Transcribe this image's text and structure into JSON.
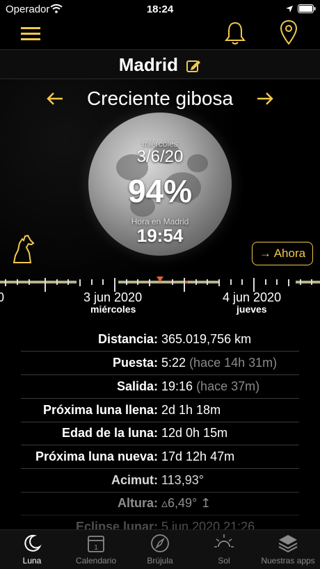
{
  "status": {
    "carrier": "Operador",
    "time": "18:24"
  },
  "header": {
    "menu_icon": "hamburger-icon",
    "bell_icon": "bell-icon",
    "location_icon": "map-pin-icon"
  },
  "city": {
    "name": "Madrid"
  },
  "phase": {
    "name": "Creciente gibosa"
  },
  "moon": {
    "weekday": "miércoles",
    "date": "3/6/20",
    "illumination": "94%",
    "time_label": "Hora en Madrid",
    "time": "19:54"
  },
  "now_button": {
    "label": "→ Ahora"
  },
  "timeline": {
    "left_partial": "0",
    "dates": [
      {
        "date": "3 jun 2020",
        "day": "miércoles"
      },
      {
        "date": "4 jun 2020",
        "day": "jueves"
      }
    ]
  },
  "rows": [
    {
      "label": "Distancia:",
      "value": "365.019,756 km",
      "note": ""
    },
    {
      "label": "Puesta:",
      "value": "5:22",
      "note": "(hace 14h 31m)"
    },
    {
      "label": "Salida:",
      "value": "19:16",
      "note": "(hace 37m)"
    },
    {
      "label": "Próxima luna llena:",
      "value": "2d 1h 18m",
      "note": ""
    },
    {
      "label": "Edad de la luna:",
      "value": "12d 0h 15m",
      "note": ""
    },
    {
      "label": "Próxima luna nueva:",
      "value": "17d 12h 47m",
      "note": ""
    },
    {
      "label": "Acimut:",
      "value": "113,93°",
      "note": ""
    },
    {
      "label": "Altura:",
      "value": "▵6,49° ↥",
      "note": ""
    },
    {
      "label": "Eclipse lunar:",
      "value": "5 jun 2020 21:26",
      "note": ""
    }
  ],
  "tabs": [
    {
      "label": "Luna",
      "icon": "moon-icon"
    },
    {
      "label": "Calendario",
      "icon": "calendar-icon"
    },
    {
      "label": "Brújula",
      "icon": "compass-icon"
    },
    {
      "label": "Sol",
      "icon": "sun-icon"
    },
    {
      "label": "Nuestras apps",
      "icon": "layers-icon"
    }
  ]
}
